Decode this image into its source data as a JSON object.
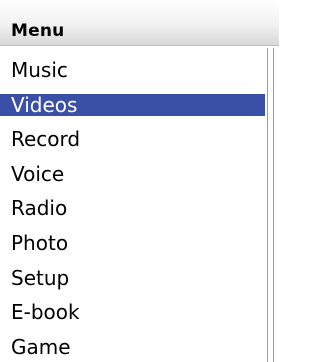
{
  "header": {
    "title": "Menu"
  },
  "menu": {
    "items": [
      {
        "label": "Music"
      },
      {
        "label": "Videos"
      },
      {
        "label": "Record"
      },
      {
        "label": "Voice"
      },
      {
        "label": "Radio"
      },
      {
        "label": "Photo"
      },
      {
        "label": "Setup"
      },
      {
        "label": "E-book"
      },
      {
        "label": "Game"
      }
    ],
    "selected_label": "Videos"
  },
  "colors": {
    "selection_background": "#3a4fa6",
    "selection_text": "#ffffff",
    "text": "#000000",
    "background": "#ffffff"
  }
}
